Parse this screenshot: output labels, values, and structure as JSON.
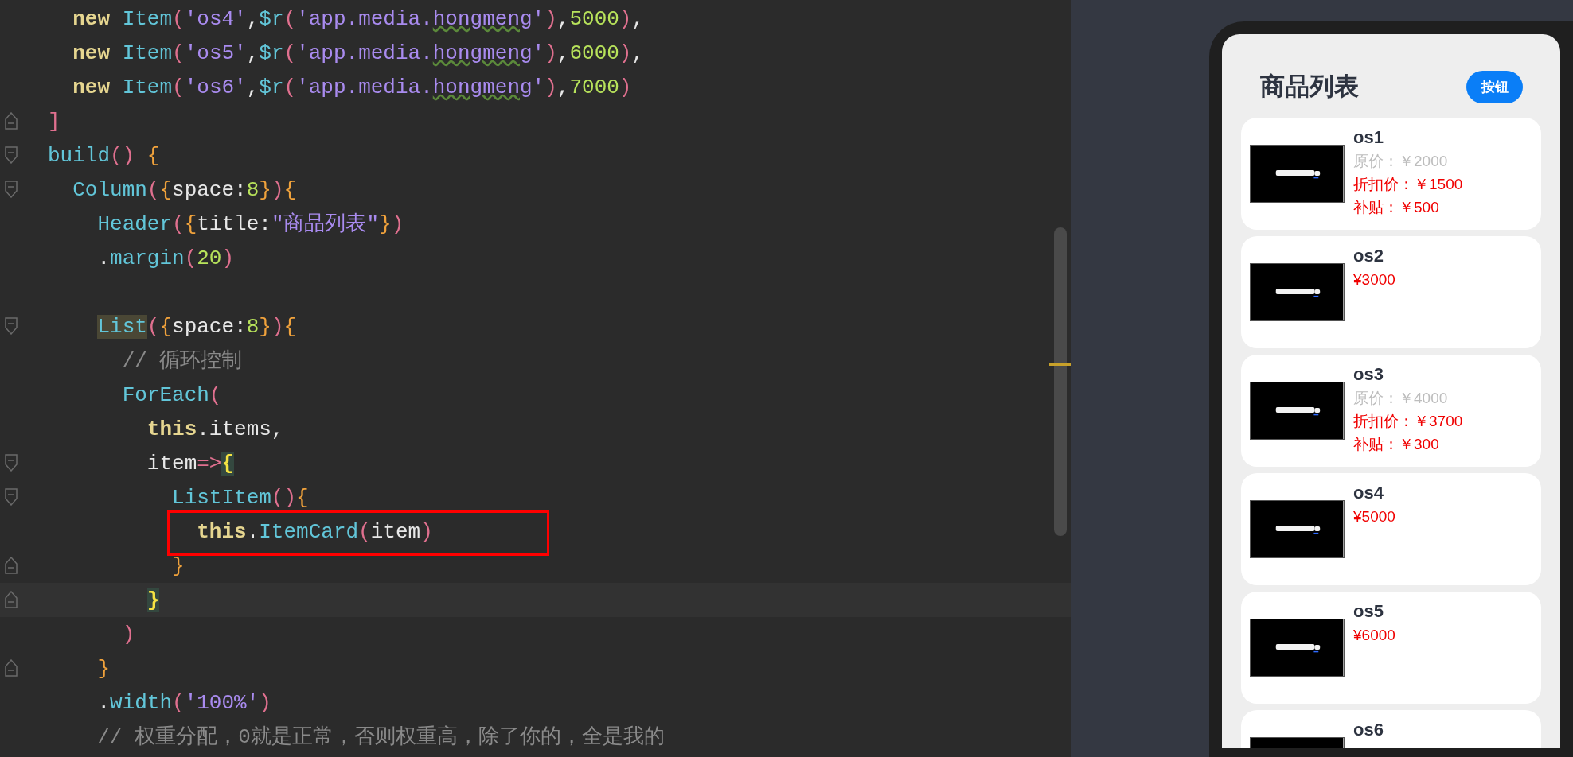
{
  "editor": {
    "lines": [
      {
        "tokens": [
          {
            "text": "  new ",
            "kind": "kw"
          },
          {
            "text": "Item",
            "kind": "fn"
          },
          {
            "text": "(",
            "kind": "paren"
          },
          {
            "text": "'os4'",
            "kind": "str"
          },
          {
            "text": ",",
            "kind": "plain"
          },
          {
            "text": "$r",
            "kind": "fn"
          },
          {
            "text": "(",
            "kind": "paren"
          },
          {
            "text": "'app.media.",
            "kind": "str"
          },
          {
            "text": "hongmeng",
            "kind": "str",
            "warning": true
          },
          {
            "text": "'",
            "kind": "str"
          },
          {
            "text": ")",
            "kind": "paren"
          },
          {
            "text": ",",
            "kind": "plain"
          },
          {
            "text": "5000",
            "kind": "num"
          },
          {
            "text": ")",
            "kind": "paren"
          },
          {
            "text": ",",
            "kind": "plain"
          }
        ]
      },
      {
        "tokens": [
          {
            "text": "  new ",
            "kind": "kw"
          },
          {
            "text": "Item",
            "kind": "fn"
          },
          {
            "text": "(",
            "kind": "paren"
          },
          {
            "text": "'os5'",
            "kind": "str"
          },
          {
            "text": ",",
            "kind": "plain"
          },
          {
            "text": "$r",
            "kind": "fn"
          },
          {
            "text": "(",
            "kind": "paren"
          },
          {
            "text": "'app.media.",
            "kind": "str"
          },
          {
            "text": "hongmeng",
            "kind": "str",
            "warning": true
          },
          {
            "text": "'",
            "kind": "str"
          },
          {
            "text": ")",
            "kind": "paren"
          },
          {
            "text": ",",
            "kind": "plain"
          },
          {
            "text": "6000",
            "kind": "num"
          },
          {
            "text": ")",
            "kind": "paren"
          },
          {
            "text": ",",
            "kind": "plain"
          }
        ]
      },
      {
        "tokens": [
          {
            "text": "  new ",
            "kind": "kw"
          },
          {
            "text": "Item",
            "kind": "fn"
          },
          {
            "text": "(",
            "kind": "paren"
          },
          {
            "text": "'os6'",
            "kind": "str"
          },
          {
            "text": ",",
            "kind": "plain"
          },
          {
            "text": "$r",
            "kind": "fn"
          },
          {
            "text": "(",
            "kind": "paren"
          },
          {
            "text": "'app.media.",
            "kind": "str"
          },
          {
            "text": "hongmeng",
            "kind": "str",
            "warning": true
          },
          {
            "text": "'",
            "kind": "str"
          },
          {
            "text": ")",
            "kind": "paren"
          },
          {
            "text": ",",
            "kind": "plain"
          },
          {
            "text": "7000",
            "kind": "num"
          },
          {
            "text": ")",
            "kind": "paren"
          }
        ]
      },
      {
        "fold_close": true,
        "tokens": [
          {
            "text": "]",
            "kind": "paren"
          }
        ]
      },
      {
        "fold_open": true,
        "tokens": [
          {
            "text": "build",
            "kind": "fn"
          },
          {
            "text": "() ",
            "kind": "paren"
          },
          {
            "text": "{",
            "kind": "brace"
          }
        ]
      },
      {
        "fold_open": true,
        "tokens": [
          {
            "text": "  Column",
            "kind": "fn"
          },
          {
            "text": "(",
            "kind": "paren"
          },
          {
            "text": "{",
            "kind": "brace"
          },
          {
            "text": "space:",
            "kind": "plain"
          },
          {
            "text": "8",
            "kind": "num"
          },
          {
            "text": "}",
            "kind": "brace"
          },
          {
            "text": ")",
            "kind": "paren"
          },
          {
            "text": "{",
            "kind": "brace"
          }
        ]
      },
      {
        "tokens": [
          {
            "text": "    Header",
            "kind": "fn"
          },
          {
            "text": "(",
            "kind": "paren"
          },
          {
            "text": "{",
            "kind": "brace"
          },
          {
            "text": "title:",
            "kind": "plain"
          },
          {
            "text": "\"商品列表\"",
            "kind": "str"
          },
          {
            "text": "}",
            "kind": "brace"
          },
          {
            "text": ")",
            "kind": "paren"
          }
        ]
      },
      {
        "tokens": [
          {
            "text": "    .",
            "kind": "plain"
          },
          {
            "text": "margin",
            "kind": "fn"
          },
          {
            "text": "(",
            "kind": "paren"
          },
          {
            "text": "20",
            "kind": "num"
          },
          {
            "text": ")",
            "kind": "paren"
          }
        ]
      },
      {
        "fold_open": true,
        "space_before": true,
        "tokens": [
          {
            "text": "    List",
            "kind": "fn",
            "highlight": true
          },
          {
            "text": "(",
            "kind": "paren"
          },
          {
            "text": "{",
            "kind": "brace"
          },
          {
            "text": "space:",
            "kind": "plain"
          },
          {
            "text": "8",
            "kind": "num"
          },
          {
            "text": "}",
            "kind": "brace"
          },
          {
            "text": ")",
            "kind": "paren"
          },
          {
            "text": "{",
            "kind": "brace"
          }
        ]
      },
      {
        "tokens": [
          {
            "text": "      // 循环控制",
            "kind": "comment"
          }
        ]
      },
      {
        "tokens": [
          {
            "text": "      ForEach",
            "kind": "fn"
          },
          {
            "text": "(",
            "kind": "paren"
          }
        ]
      },
      {
        "tokens": [
          {
            "text": "        this",
            "kind": "kw"
          },
          {
            "text": ".items,",
            "kind": "plain"
          }
        ]
      },
      {
        "fold_open": true,
        "tokens": [
          {
            "text": "        item",
            "kind": "plain"
          },
          {
            "text": "=>",
            "kind": "paren"
          },
          {
            "text": "{",
            "kind": "match",
            "highlight": true
          }
        ]
      },
      {
        "fold_open": true,
        "tokens": [
          {
            "text": "          ListItem",
            "kind": "fn"
          },
          {
            "text": "()",
            "kind": "paren"
          },
          {
            "text": "{",
            "kind": "brace"
          }
        ]
      },
      {
        "boxed": true,
        "tokens": [
          {
            "text": "            this",
            "kind": "kw"
          },
          {
            "text": ".",
            "kind": "plain"
          },
          {
            "text": "ItemCard",
            "kind": "fn"
          },
          {
            "text": "(",
            "kind": "paren"
          },
          {
            "text": "item",
            "kind": "plain"
          },
          {
            "text": ")",
            "kind": "paren"
          }
        ]
      },
      {
        "fold_close": true,
        "tokens": [
          {
            "text": "          }",
            "kind": "brace"
          }
        ]
      },
      {
        "fold_close": true,
        "current": true,
        "tokens": [
          {
            "text": "        }",
            "kind": "match",
            "highlight": true
          }
        ]
      },
      {
        "tokens": [
          {
            "text": "      )",
            "kind": "paren"
          }
        ]
      },
      {
        "fold_close": true,
        "tokens": [
          {
            "text": "    }",
            "kind": "brace"
          }
        ]
      },
      {
        "tokens": [
          {
            "text": "    .",
            "kind": "plain"
          },
          {
            "text": "width",
            "kind": "fn"
          },
          {
            "text": "(",
            "kind": "paren"
          },
          {
            "text": "'100%'",
            "kind": "str"
          },
          {
            "text": ")",
            "kind": "paren"
          }
        ]
      },
      {
        "tokens": [
          {
            "text": "    // 权重分配，0就是正常，否则权重高，除了你的，全是我的",
            "kind": "comment"
          }
        ]
      }
    ]
  },
  "preview": {
    "title": "商品列表",
    "button": "按钮",
    "items": [
      {
        "kind": "discount",
        "name": "os1",
        "original": "原价：￥2000",
        "discounted": "折扣价：￥1500",
        "subsidy": "补贴：￥500"
      },
      {
        "kind": "plain",
        "name": "os2",
        "price": "¥3000"
      },
      {
        "kind": "discount",
        "name": "os3",
        "original": "原价：￥4000",
        "discounted": "折扣价：￥3700",
        "subsidy": "补贴：￥300"
      },
      {
        "kind": "plain",
        "name": "os4",
        "price": "¥5000"
      },
      {
        "kind": "plain",
        "name": "os5",
        "price": "¥6000"
      },
      {
        "kind": "plain",
        "name": "os6"
      }
    ]
  }
}
